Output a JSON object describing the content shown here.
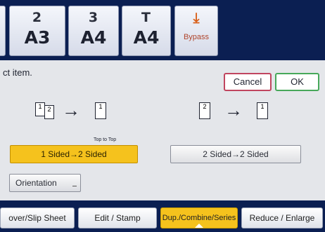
{
  "trays": [
    {
      "top": "2",
      "size": "A3"
    },
    {
      "top": "3",
      "size": "A4"
    },
    {
      "top": "T",
      "size": "A4"
    }
  ],
  "bypass": {
    "icon": "bypass-tray-icon",
    "label": "Bypass"
  },
  "message": "ct item.",
  "buttons": {
    "cancel": "Cancel",
    "ok": "OK"
  },
  "diagram_1to2": {
    "caption": "Top to Top"
  },
  "options": {
    "one_to_two": "1 Sided→2 Sided",
    "two_to_two": "2 Sided→2 Sided"
  },
  "orientation_label": "Orientation",
  "tabs": [
    {
      "label": "over/Slip Sheet"
    },
    {
      "label": "Edit / Stamp"
    },
    {
      "label": "Dup./Combine/Series",
      "active": true
    },
    {
      "label": "Reduce / Enlarge"
    }
  ],
  "colors": {
    "accent": "#f5c21d",
    "header": "#0b1f52",
    "cancel_border": "#c0455f",
    "ok_border": "#47a85a"
  }
}
